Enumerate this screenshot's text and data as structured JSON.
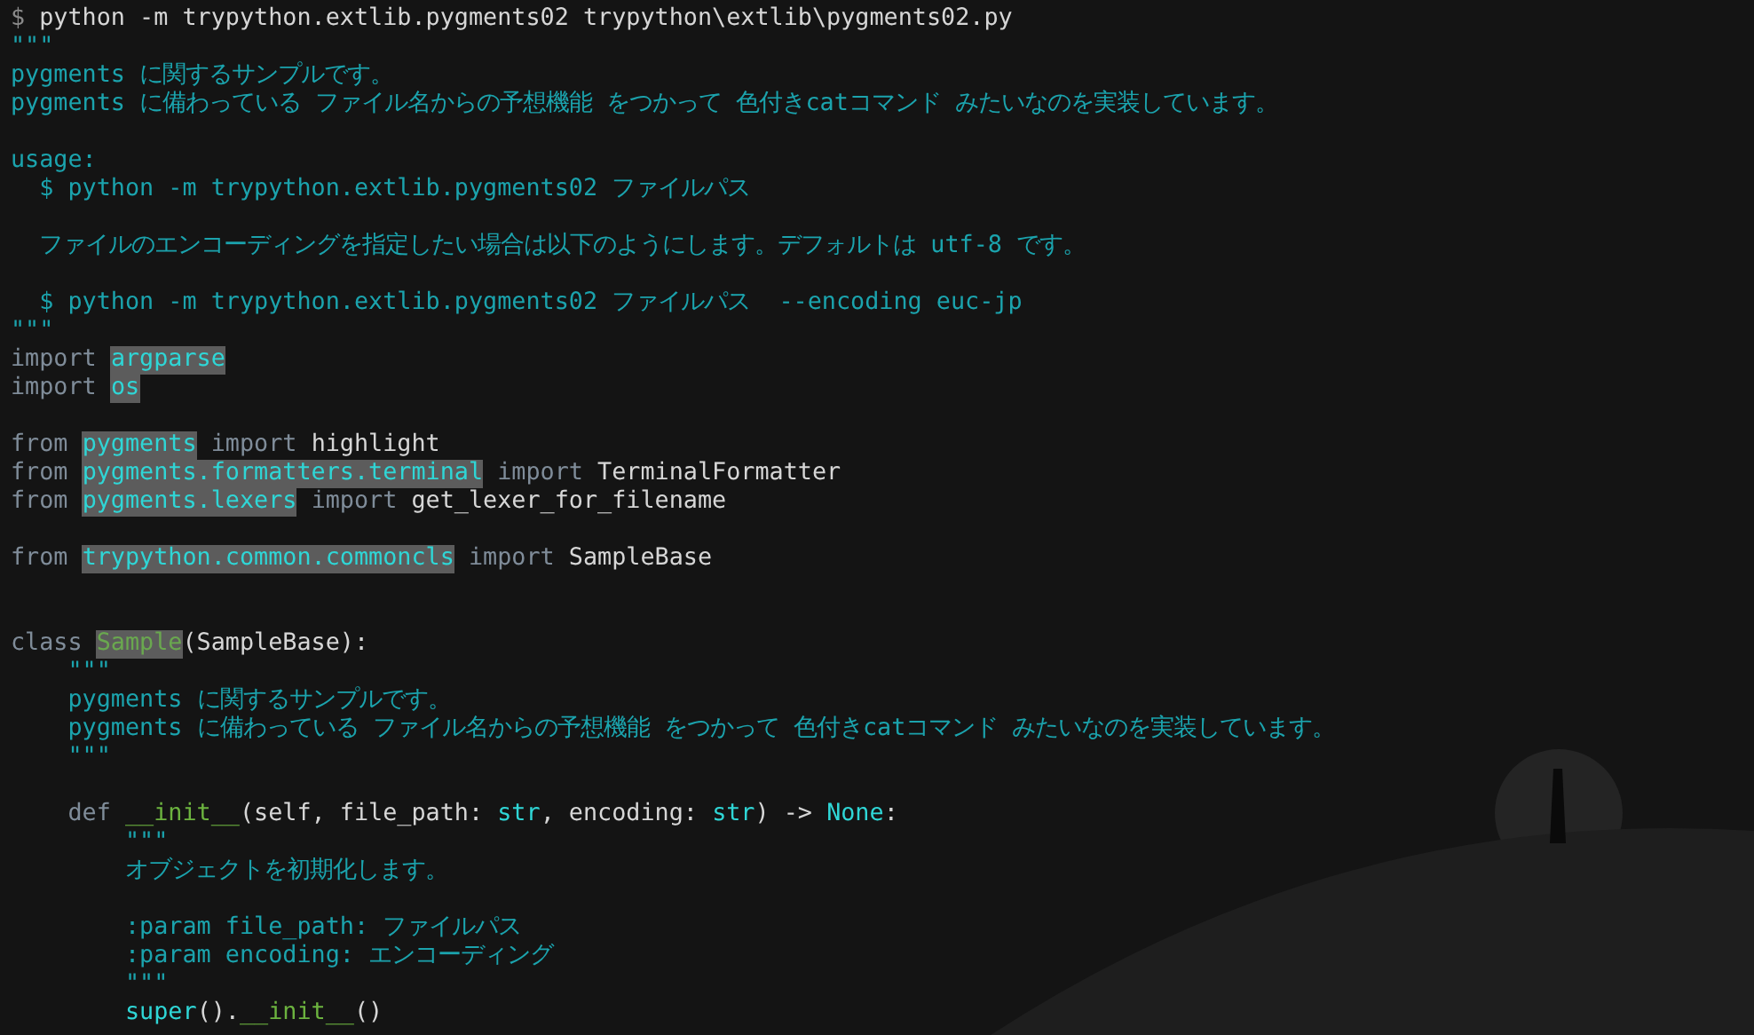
{
  "terminal": {
    "lines": [
      {
        "kind": "code",
        "segments": [
          {
            "kind": "prompt",
            "text": "$"
          },
          {
            "kind": "plain",
            "text": " python -m trypython.extlib.pygments02 trypython\\extlib\\pygments02.py"
          }
        ]
      },
      {
        "kind": "code",
        "segments": [
          {
            "kind": "doc",
            "text": "\"\"\""
          }
        ]
      },
      {
        "kind": "code",
        "segments": [
          {
            "kind": "doc",
            "text": "pygments に関するサンプルです。"
          }
        ]
      },
      {
        "kind": "code",
        "segments": [
          {
            "kind": "doc",
            "text": "pygments に備わっている ファイル名からの予想機能 をつかって 色付きcatコマンド みたいなのを実装しています。"
          }
        ]
      },
      {
        "kind": "blank"
      },
      {
        "kind": "code",
        "segments": [
          {
            "kind": "doc",
            "text": "usage:"
          }
        ]
      },
      {
        "kind": "code",
        "segments": [
          {
            "kind": "doc",
            "text": "  $ python -m trypython.extlib.pygments02 ファイルパス"
          }
        ]
      },
      {
        "kind": "blank"
      },
      {
        "kind": "code",
        "segments": [
          {
            "kind": "doc",
            "text": "  ファイルのエンコーディングを指定したい場合は以下のようにします。デフォルトは utf-8 です。"
          }
        ]
      },
      {
        "kind": "blank"
      },
      {
        "kind": "code",
        "segments": [
          {
            "kind": "doc",
            "text": "  $ python -m trypython.extlib.pygments02 ファイルパス  --encoding euc-jp"
          }
        ]
      },
      {
        "kind": "code",
        "segments": [
          {
            "kind": "doc",
            "text": "\"\"\""
          }
        ]
      },
      {
        "kind": "code",
        "segments": [
          {
            "kind": "keyword",
            "text": "import "
          },
          {
            "kind": "module",
            "text": "argparse"
          }
        ]
      },
      {
        "kind": "code",
        "segments": [
          {
            "kind": "keyword",
            "text": "import "
          },
          {
            "kind": "module",
            "text": "os"
          }
        ]
      },
      {
        "kind": "blank"
      },
      {
        "kind": "code",
        "segments": [
          {
            "kind": "keyword",
            "text": "from "
          },
          {
            "kind": "module",
            "text": "pygments"
          },
          {
            "kind": "keyword",
            "text": " import "
          },
          {
            "kind": "plain",
            "text": "highlight"
          }
        ]
      },
      {
        "kind": "code",
        "segments": [
          {
            "kind": "keyword",
            "text": "from "
          },
          {
            "kind": "module",
            "text": "pygments.formatters.terminal"
          },
          {
            "kind": "keyword",
            "text": " import "
          },
          {
            "kind": "plain",
            "text": "TerminalFormatter"
          }
        ]
      },
      {
        "kind": "code",
        "segments": [
          {
            "kind": "keyword",
            "text": "from "
          },
          {
            "kind": "module",
            "text": "pygments.lexers"
          },
          {
            "kind": "keyword",
            "text": " import "
          },
          {
            "kind": "plain",
            "text": "get_lexer_for_filename"
          }
        ]
      },
      {
        "kind": "blank"
      },
      {
        "kind": "code",
        "segments": [
          {
            "kind": "keyword",
            "text": "from "
          },
          {
            "kind": "module",
            "text": "trypython.common.commoncls"
          },
          {
            "kind": "keyword",
            "text": " import "
          },
          {
            "kind": "plain",
            "text": "SampleBase"
          }
        ]
      },
      {
        "kind": "blank"
      },
      {
        "kind": "blank"
      },
      {
        "kind": "code",
        "segments": [
          {
            "kind": "keyword",
            "text": "class "
          },
          {
            "kind": "classname",
            "text": "Sample"
          },
          {
            "kind": "plain",
            "text": "(SampleBase):"
          }
        ]
      },
      {
        "kind": "code",
        "segments": [
          {
            "kind": "doc",
            "text": "    \"\"\""
          }
        ]
      },
      {
        "kind": "code",
        "segments": [
          {
            "kind": "doc",
            "text": "    pygments に関するサンプルです。"
          }
        ]
      },
      {
        "kind": "code",
        "segments": [
          {
            "kind": "doc",
            "text": "    pygments に備わっている ファイル名からの予想機能 をつかって 色付きcatコマンド みたいなのを実装しています。"
          }
        ]
      },
      {
        "kind": "code",
        "segments": [
          {
            "kind": "doc",
            "text": "    \"\"\""
          }
        ]
      },
      {
        "kind": "blank"
      },
      {
        "kind": "code",
        "segments": [
          {
            "kind": "keyword",
            "text": "    def "
          },
          {
            "kind": "func",
            "text": "__init__"
          },
          {
            "kind": "plain",
            "text": "(self, file_path: "
          },
          {
            "kind": "builtin",
            "text": "str"
          },
          {
            "kind": "plain",
            "text": ", encoding: "
          },
          {
            "kind": "builtin",
            "text": "str"
          },
          {
            "kind": "plain",
            "text": ") -> "
          },
          {
            "kind": "builtin",
            "text": "None"
          },
          {
            "kind": "plain",
            "text": ":"
          }
        ]
      },
      {
        "kind": "code",
        "segments": [
          {
            "kind": "doc",
            "text": "        \"\"\""
          }
        ]
      },
      {
        "kind": "code",
        "segments": [
          {
            "kind": "doc",
            "text": "        オブジェクトを初期化します。"
          }
        ]
      },
      {
        "kind": "blank"
      },
      {
        "kind": "code",
        "segments": [
          {
            "kind": "doc",
            "text": "        :param file_path: ファイルパス"
          }
        ]
      },
      {
        "kind": "code",
        "segments": [
          {
            "kind": "doc",
            "text": "        :param encoding: エンコーディング"
          }
        ]
      },
      {
        "kind": "code",
        "segments": [
          {
            "kind": "doc",
            "text": "        \"\"\""
          }
        ]
      },
      {
        "kind": "code",
        "segments": [
          {
            "kind": "builtin",
            "text": "        super"
          },
          {
            "kind": "plain",
            "text": "()."
          },
          {
            "kind": "func",
            "text": "__init__"
          },
          {
            "kind": "plain",
            "text": "()"
          }
        ]
      }
    ]
  }
}
